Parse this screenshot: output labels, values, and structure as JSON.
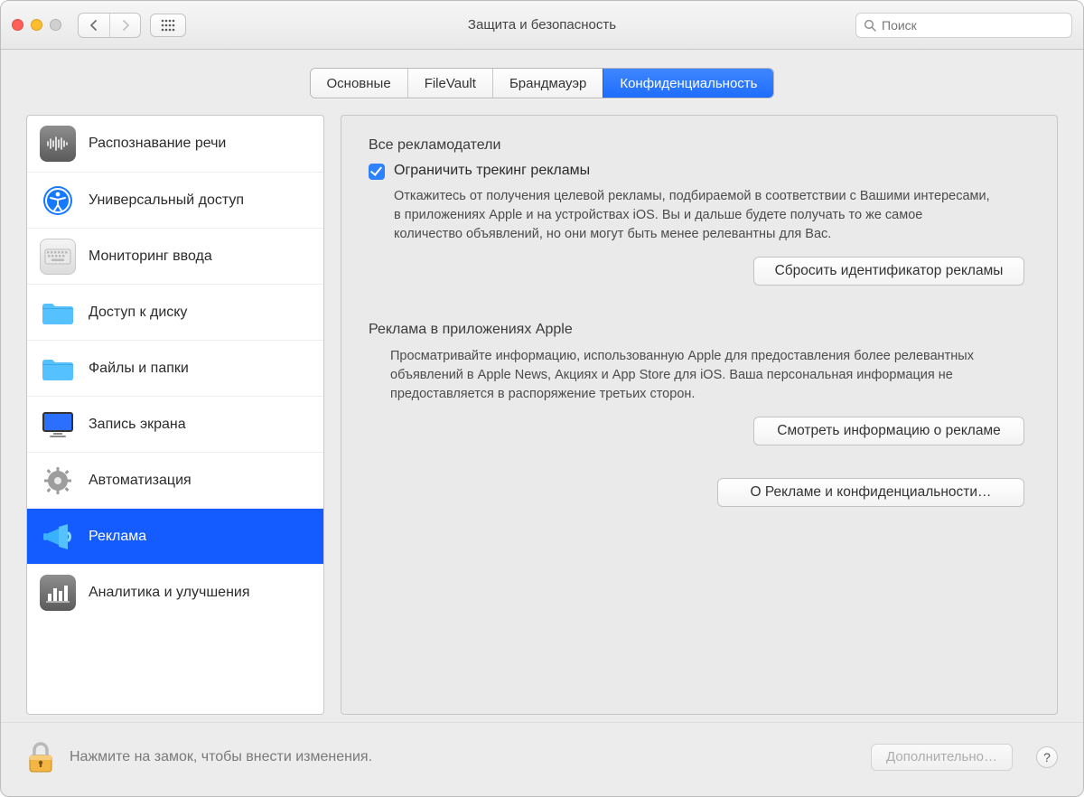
{
  "window": {
    "title": "Защита и безопасность"
  },
  "search": {
    "placeholder": "Поиск"
  },
  "tabs": [
    {
      "label": "Основные"
    },
    {
      "label": "FileVault"
    },
    {
      "label": "Брандмауэр"
    },
    {
      "label": "Конфиденциальность"
    }
  ],
  "sidebar": {
    "items": [
      {
        "label": "Распознавание речи"
      },
      {
        "label": "Универсальный доступ"
      },
      {
        "label": "Мониторинг ввода"
      },
      {
        "label": "Доступ к диску"
      },
      {
        "label": "Файлы и папки"
      },
      {
        "label": "Запись экрана"
      },
      {
        "label": "Автоматизация"
      },
      {
        "label": "Реклама"
      },
      {
        "label": "Аналитика и улучшения"
      }
    ]
  },
  "detail": {
    "section1": {
      "heading": "Все рекламодатели",
      "checkbox_label": "Ограничить трекинг рекламы",
      "checkbox_checked": true,
      "description": "Откажитесь от получения целевой рекламы, подбираемой в соответствии с Вашими интересами, в приложениях Apple и на устройствах iOS. Вы и дальше будете получать то же самое количество объявлений, но они могут быть менее релевантны для Вас.",
      "button_label": "Сбросить идентификатор рекламы"
    },
    "section2": {
      "heading": "Реклама в приложениях Apple",
      "description": "Просматривайте информацию, использованную Apple для предоставления более релевантных объявлений в Apple News, Акциях и App Store для iOS. Ваша персональная информация не предоставляется в распоряжение третьих сторон.",
      "button_label": "Смотреть информацию о рекламе"
    },
    "about_button": "О Рекламе и конфиденциальности…"
  },
  "footer": {
    "lock_text": "Нажмите на замок, чтобы внести изменения.",
    "advanced_label": "Дополнительно…",
    "help_label": "?"
  }
}
